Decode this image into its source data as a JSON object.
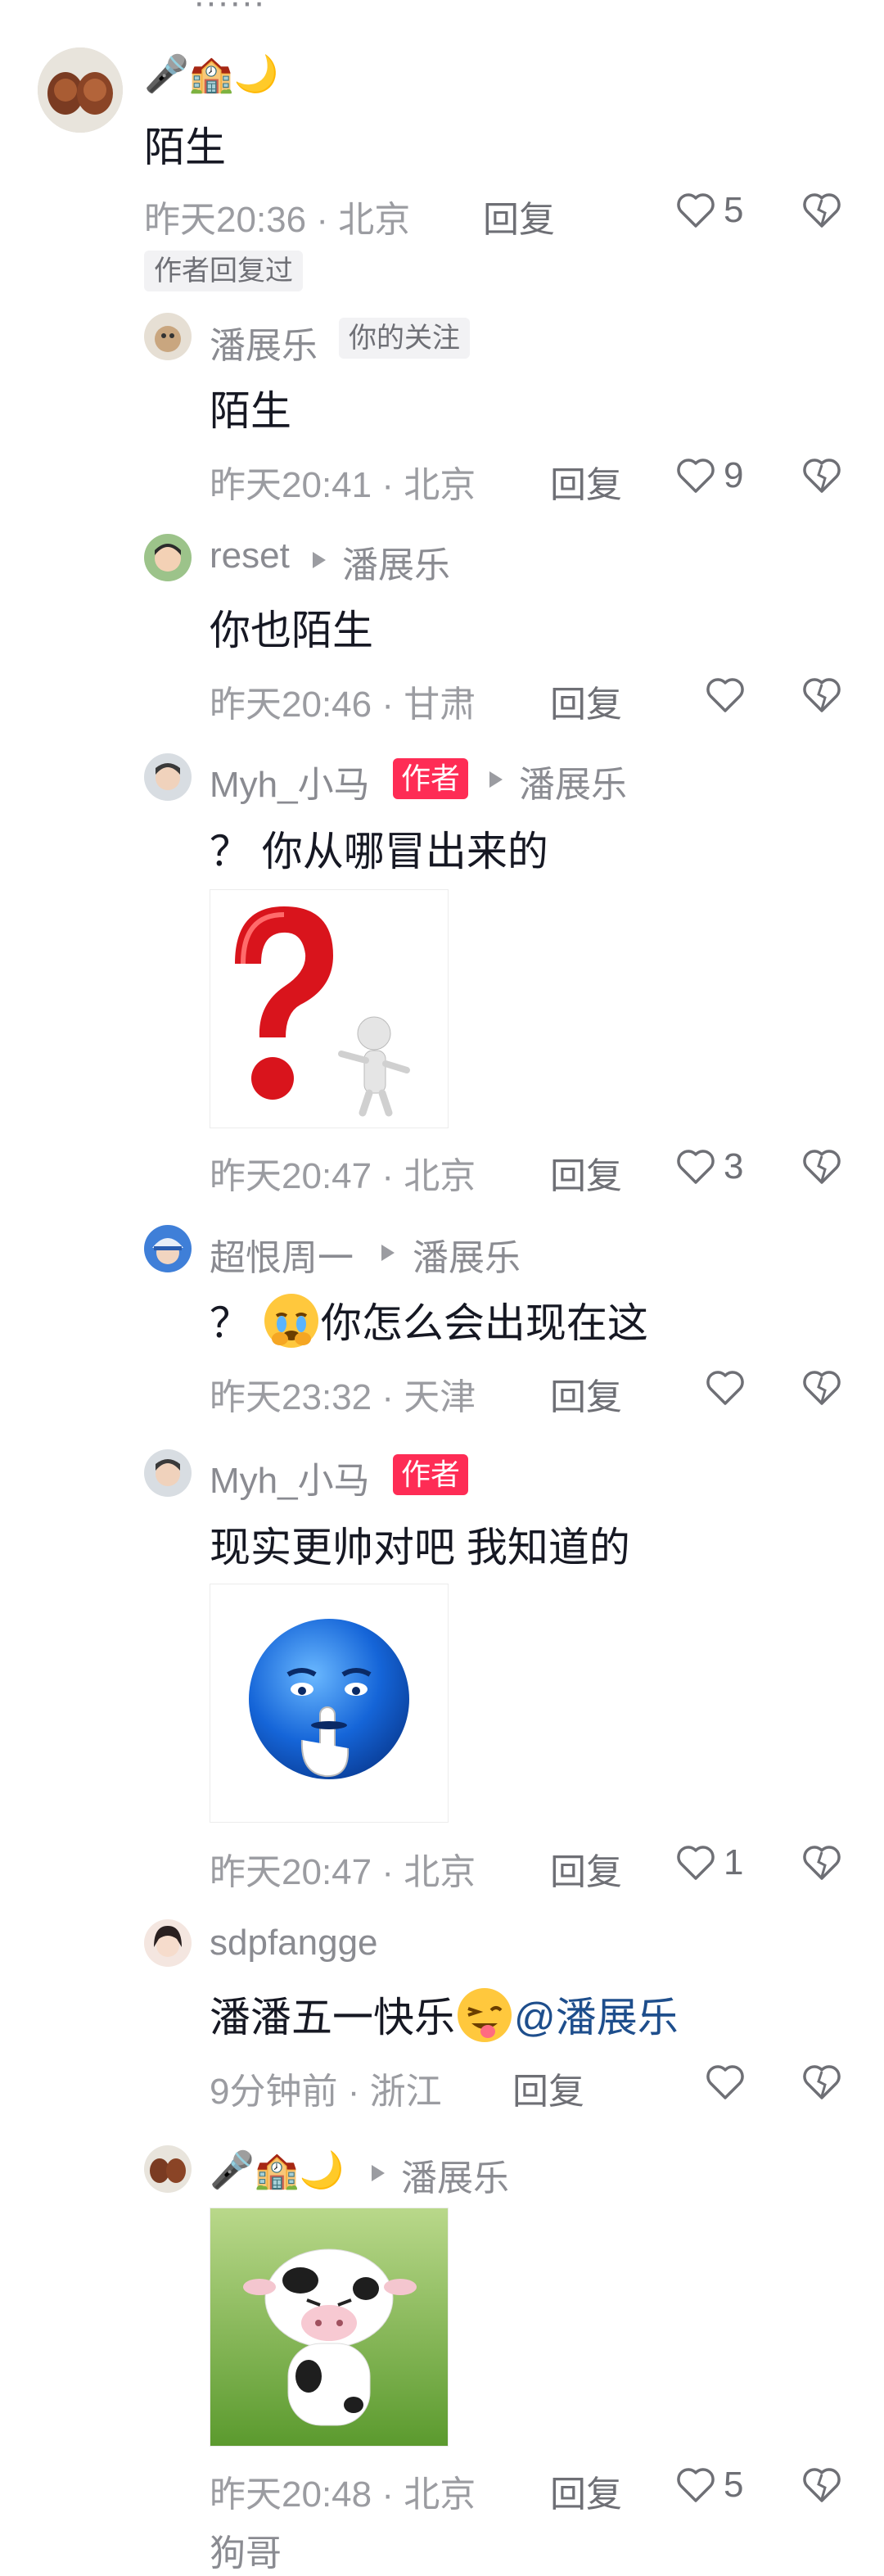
{
  "comments": [
    {
      "user": "🎤🏫🌙",
      "text": "陌生",
      "time": "昨天20:36 · 北京",
      "reply": "回复",
      "likes": "5",
      "badge": "作者回复过"
    },
    {
      "user": "潘展乐",
      "tag": "你的关注",
      "text": "陌生",
      "time": "昨天20:41 · 北京",
      "reply": "回复",
      "likes": "9"
    },
    {
      "user": "reset",
      "to": "潘展乐",
      "text": "你也陌生",
      "time": "昨天20:46 · 甘肃",
      "reply": "回复",
      "likes": ""
    },
    {
      "user": "Myh_小马",
      "author": "作者",
      "to": "潘展乐",
      "text": "？ 你从哪冒出来的",
      "time": "昨天20:47 · 北京",
      "reply": "回复",
      "likes": "3"
    },
    {
      "user": "超恨周一",
      "to": "潘展乐",
      "text": "？ ",
      "text2": "你怎么会出现在这",
      "time": "昨天23:32 · 天津",
      "reply": "回复",
      "likes": ""
    },
    {
      "user": "Myh_小马",
      "author": "作者",
      "text": "现实更帅对吧 我知道的",
      "time": "昨天20:47 · 北京",
      "reply": "回复",
      "likes": "1"
    },
    {
      "user": "sdpfangge",
      "text": "潘潘五一快乐",
      "mention": "@潘展乐",
      "time": "9分钟前 · 浙江",
      "reply": "回复",
      "likes": ""
    },
    {
      "user": "🎤🏫🌙",
      "to": "潘展乐",
      "time": "昨天20:48 · 北京",
      "reply": "回复",
      "likes": "5"
    }
  ],
  "bottom_name": "狗哥"
}
